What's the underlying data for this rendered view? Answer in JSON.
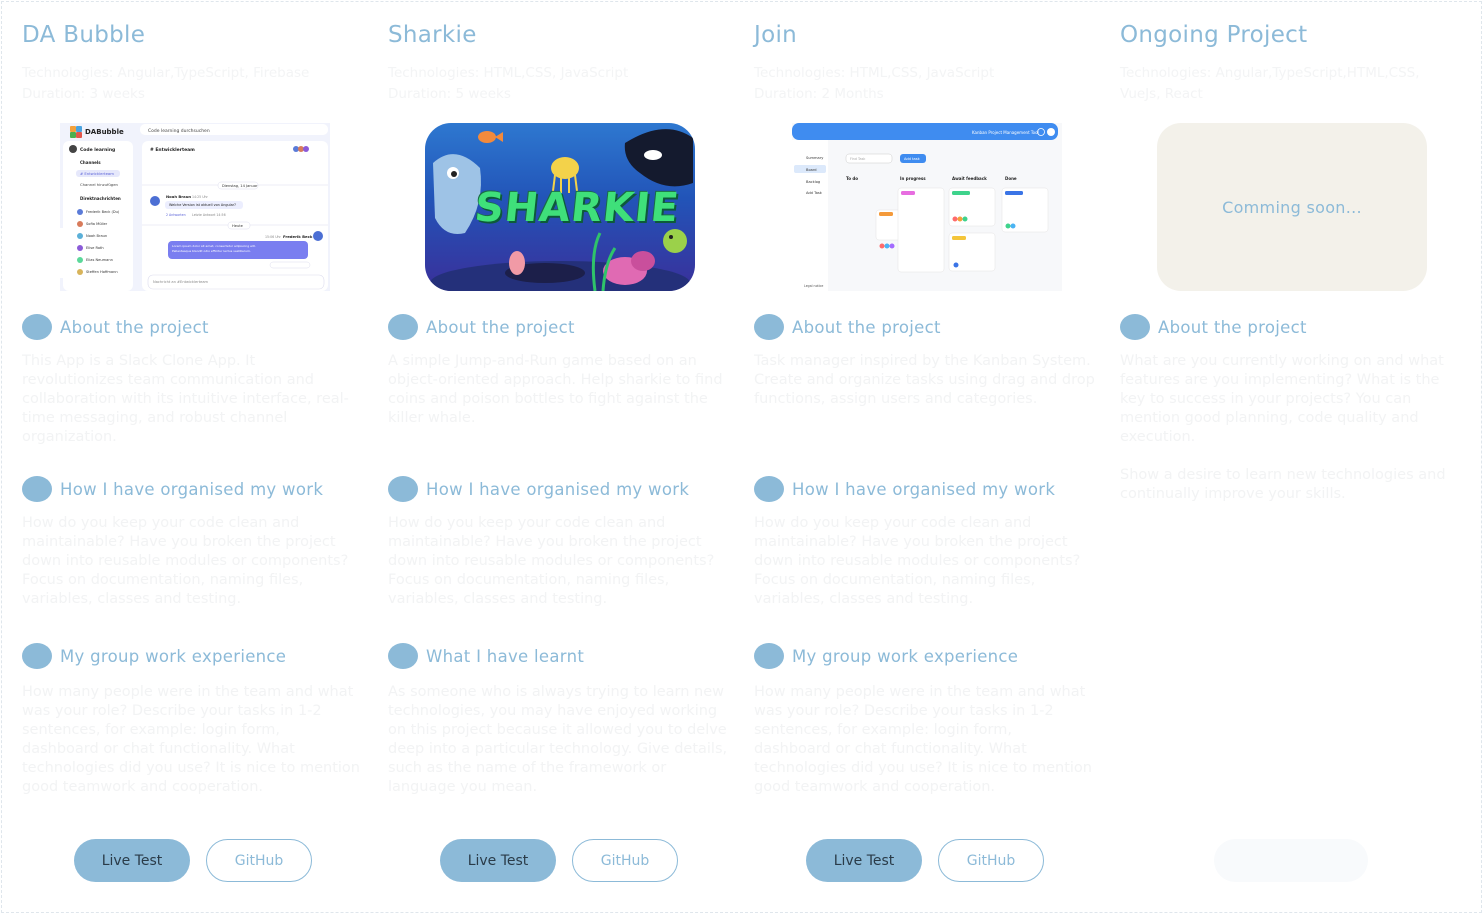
{
  "projects": [
    {
      "title": "DA Bubble",
      "technologies": "Technologies: Angular,TypeScript, Firebase",
      "duration": "Duration: 3 weeks",
      "sections": [
        {
          "label": "About the project",
          "text": "This App is a Slack Clone App. It revolutionizes team communication and collaboration with its intuitive interface, real-time messaging, and robust channel organization."
        },
        {
          "label": "How I have organised my work",
          "text": "How do you keep your code clean and maintainable? Have you broken the project down into reusable modules or components? Focus on documentation, naming files, variables, classes and testing."
        },
        {
          "label": "My group work experience",
          "text": "How many people were in the team and what was your role? Describe your tasks in 1-2 sentences, for example: login form, dashboard or chat functionality. What technologies did you use? It is nice to mention good teamwork and cooperation."
        }
      ],
      "live_label": "Live Test",
      "github_label": "GitHub",
      "screenshot": {
        "app_name": "DABubble",
        "search": "Code learning durchsuchen",
        "workspace": "Code learning",
        "channels_label": "Channels",
        "channel_active": "# Entwicklerteam",
        "add_channel": "Channel hinzufügen",
        "direct_label": "Direktnachrichten",
        "users": [
          "Frederik Beck (Du)",
          "Sofia Müller",
          "Noah Braun",
          "Elise Roth",
          "Elias Neumann",
          "Steffen Hoffmann"
        ],
        "channel_header": "# Entwicklerteam",
        "date1": "Dienstag, 14 Januar",
        "msg1_author": "Noah Braun",
        "msg1_time": "14:25 Uhr",
        "msg1_text": "Welche Version ist aktuell von Angular?",
        "msg1_replies": "2 Antworten",
        "msg1_last": "Letzte Antwort 14:56",
        "date2": "Heute",
        "msg2_time": "15:06 Uhr",
        "msg2_author": "Frederik Beck",
        "msg2_text": "Lorem ipsum dolor sit amet, consectetur adipiscing elit. Pellentesque blandit odio efficitur lectus vestibulum, quis accumsan ante vulputate. Quisque tristique iaculis erat, eu faucibus lacus iaculis ac.",
        "input_placeholder": "Nachricht an #Entwicklerteam",
        "side_tab": "Workspace-Menü schließen"
      }
    },
    {
      "title": "Sharkie",
      "technologies": "Technologies: HTML,CSS, JavaScript",
      "duration": "Duration: 5 weeks",
      "sections": [
        {
          "label": "About the project",
          "text": "A simple Jump-and-Run game based on an object-oriented approach. Help sharkie to find coins and poison bottles to fight against the killer whale."
        },
        {
          "label": "How I have organised my work",
          "text": "How do you keep your code clean and maintainable? Have you broken the project down into reusable modules or components? Focus on documentation, naming files, variables, classes and testing."
        },
        {
          "label": "What I have learnt",
          "text": "As someone who is always trying to learn new technologies, you may have enjoyed working on this project because it allowed you to delve deep into a particular technology. Give details, such as the name of the framework or language you mean."
        }
      ],
      "live_label": "Live Test",
      "github_label": "GitHub",
      "screenshot": {
        "logo_text": "SHARKIE"
      }
    },
    {
      "title": "Join",
      "technologies": "Technologies: HTML,CSS, JavaScript",
      "duration": "Duration: 2 Months",
      "sections": [
        {
          "label": "About the project",
          "text": "Task manager inspired by the Kanban System. Create and organize tasks using drag and drop functions, assign users and categories."
        },
        {
          "label": "How I have organised my work",
          "text": "How do you keep your code clean and maintainable? Have you broken the project down into reusable modules or components? Focus on documentation, naming files, variables, classes and testing."
        },
        {
          "label": "My group work experience",
          "text": "How many people were in the team and what was your role? Describe your tasks in 1-2 sentences, for example: login form, dashboard or chat functionality. What technologies did you use? It is nice to mention good teamwork and cooperation."
        }
      ],
      "live_label": "Live Test",
      "github_label": "GitHub",
      "screenshot": {
        "header_title": "Kanban Project Management Tool",
        "nav": [
          "Summary",
          "Board",
          "Backlog",
          "Add Task"
        ],
        "find_placeholder": "Find Task",
        "add_task": "Add task",
        "columns": [
          "To do",
          "In progress",
          "Await feedback",
          "Done"
        ],
        "footer": "Legal notice"
      }
    },
    {
      "title": "Ongoing Project",
      "technologies": "Technologies: Angular,TypeScript,HTML,CSS, VueJs, React",
      "sections": [
        {
          "label": "About the project",
          "text": "What are you currently working on and what features are you implementing? What is the key to success in your projects?  You can mention good planning,  code quality and execution."
        }
      ],
      "extra_text": "Show a desire to learn new technologies and continually improve your skills.",
      "soon_label": "Comming soon..."
    }
  ]
}
